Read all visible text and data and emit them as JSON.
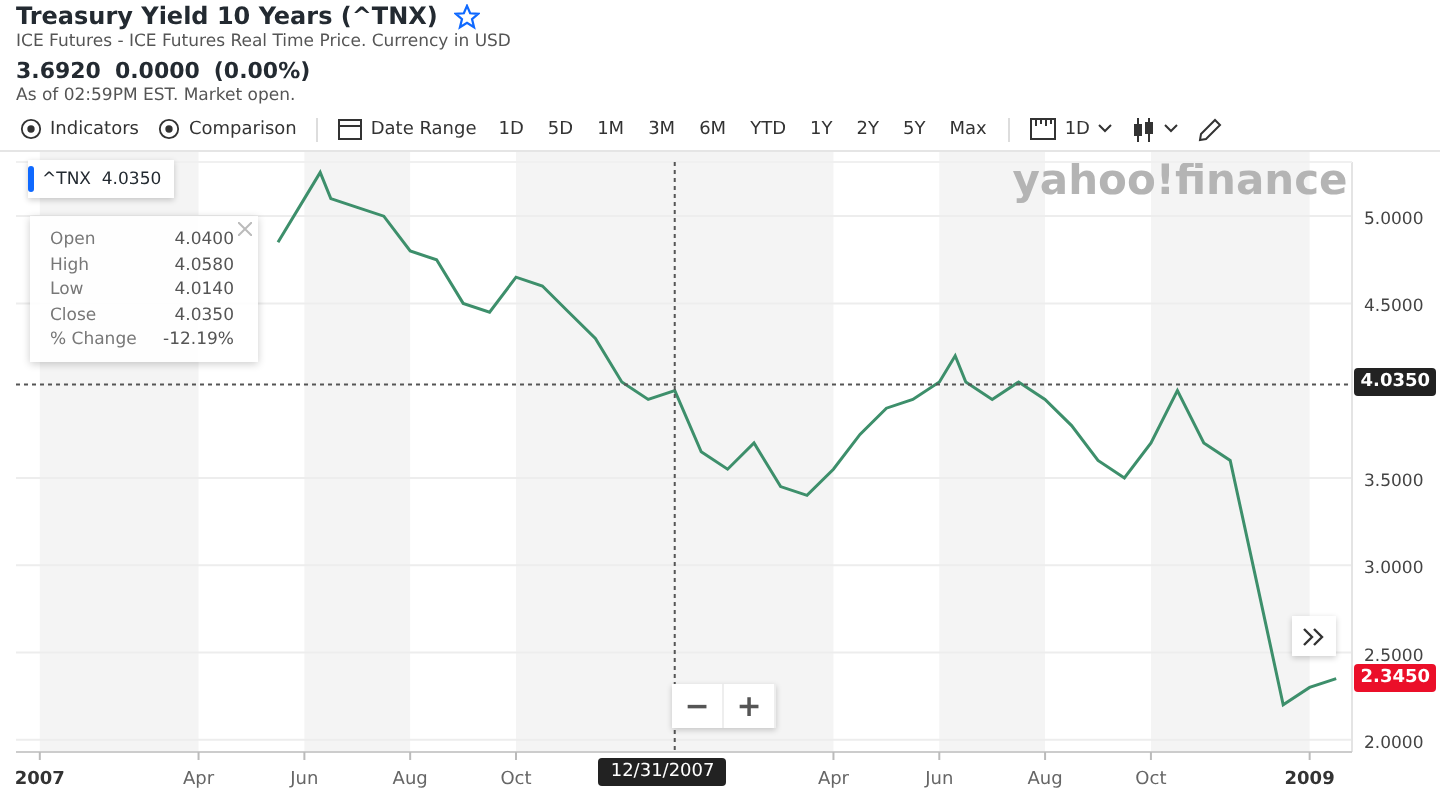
{
  "header": {
    "title": "Treasury Yield 10 Years (^TNX)",
    "subtitle": "ICE Futures - ICE Futures Real Time Price. Currency in USD",
    "price": "3.6920",
    "change": "0.0000",
    "change_percent": "(0.00%)",
    "as_of": "As of 02:59PM EST. Market open.",
    "watchlisted": false
  },
  "toolbar": {
    "tools": [
      {
        "label": "Indicators"
      },
      {
        "label": "Comparison"
      }
    ],
    "date_range": "Date Range",
    "ranges": [
      {
        "label": "1D",
        "selected": false
      },
      {
        "label": "5D",
        "selected": false
      },
      {
        "label": "1M",
        "selected": false
      },
      {
        "label": "3M",
        "selected": false
      },
      {
        "label": "6M",
        "selected": false
      },
      {
        "label": "YTD",
        "selected": false
      },
      {
        "label": "1Y",
        "selected": false
      },
      {
        "label": "2Y",
        "selected": false
      },
      {
        "label": "5Y",
        "selected": false
      },
      {
        "label": "Max",
        "selected": false
      }
    ],
    "interval": "1D"
  },
  "chart": {
    "logo": "yahoo!finance",
    "legend": {
      "value": "4.0350"
    },
    "tooltip": {
      "rows": [
        {
          "label": "Open",
          "value": "4.0400"
        },
        {
          "label": "High",
          "value": "4.0580"
        },
        {
          "label": "Low",
          "value": "4.0140"
        },
        {
          "label": "Close",
          "value": "4.0350"
        },
        {
          "label": "% Change",
          "value": "-12.19%"
        }
      ]
    },
    "crosshair": {
      "date": "12/31/2007",
      "value_label": "4.0350"
    },
    "last_price": {
      "label": "2.3450"
    },
    "zoom_buttons": [
      "−",
      "+"
    ],
    "chart_data": {
      "type": "line",
      "grid": true,
      "xlim": [
        2006.9625,
        2009.0667
      ],
      "ylim": [
        1.93,
        5.31
      ],
      "x": [
        2007.375,
        2007.4167,
        2007.4417,
        2007.4583,
        2007.5,
        2007.5417,
        2007.5833,
        2007.625,
        2007.6667,
        2007.7083,
        2007.75,
        2007.7917,
        2007.8333,
        2007.875,
        2007.9167,
        2007.9583,
        2008,
        2008.0417,
        2008.0833,
        2008.125,
        2008.1667,
        2008.2083,
        2008.25,
        2008.2917,
        2008.3333,
        2008.375,
        2008.4167,
        2008.4417,
        2008.4583,
        2008.5,
        2008.5417,
        2008.5833,
        2008.625,
        2008.6667,
        2008.7083,
        2008.75,
        2008.7917,
        2008.8333,
        2008.875,
        2008.9167,
        2008.9583,
        2009,
        2009.0417
      ],
      "series": [
        {
          "name": "^TNX",
          "color": "#3d8f6b",
          "values": [
            4.85,
            5.1,
            5.25,
            5.1,
            5.05,
            5.0,
            4.8,
            4.75,
            4.5,
            4.45,
            4.65,
            4.6,
            4.45,
            4.3,
            4.05,
            3.95,
            4.0,
            3.65,
            3.55,
            3.7,
            3.45,
            3.4,
            3.55,
            3.75,
            3.9,
            3.95,
            4.05,
            4.2,
            4.05,
            3.95,
            4.05,
            3.95,
            3.8,
            3.6,
            3.5,
            3.7,
            4.0,
            3.7,
            3.6,
            2.9,
            2.2,
            2.3,
            2.35
          ]
        }
      ],
      "xticks": [
        {
          "value": 2007,
          "label": "2007"
        },
        {
          "value": 2007.25,
          "label": "Apr"
        },
        {
          "value": 2007.4167,
          "label": "Jun"
        },
        {
          "value": 2007.5833,
          "label": "Aug"
        },
        {
          "value": 2007.75,
          "label": "Oct"
        },
        {
          "value": 2008.25,
          "label": "Apr"
        },
        {
          "value": 2008.4167,
          "label": "Jun"
        },
        {
          "value": 2008.5833,
          "label": "Aug"
        },
        {
          "value": 2008.75,
          "label": "Oct"
        },
        {
          "value": 2009,
          "label": "2009"
        }
      ],
      "yticks": [
        {
          "value": 2,
          "label": "2.0000"
        },
        {
          "value": 2.5,
          "label": "2.5000"
        },
        {
          "value": 3,
          "label": "3.0000"
        },
        {
          "value": 3.5,
          "label": "3.5000"
        },
        {
          "value": 4.5,
          "label": "4.5000"
        },
        {
          "value": 5,
          "label": "5.0000"
        }
      ],
      "ref_lines": [
        {
          "axis": "x",
          "value": 2008
        },
        {
          "axis": "y",
          "value": 4.035
        }
      ]
    }
  }
}
